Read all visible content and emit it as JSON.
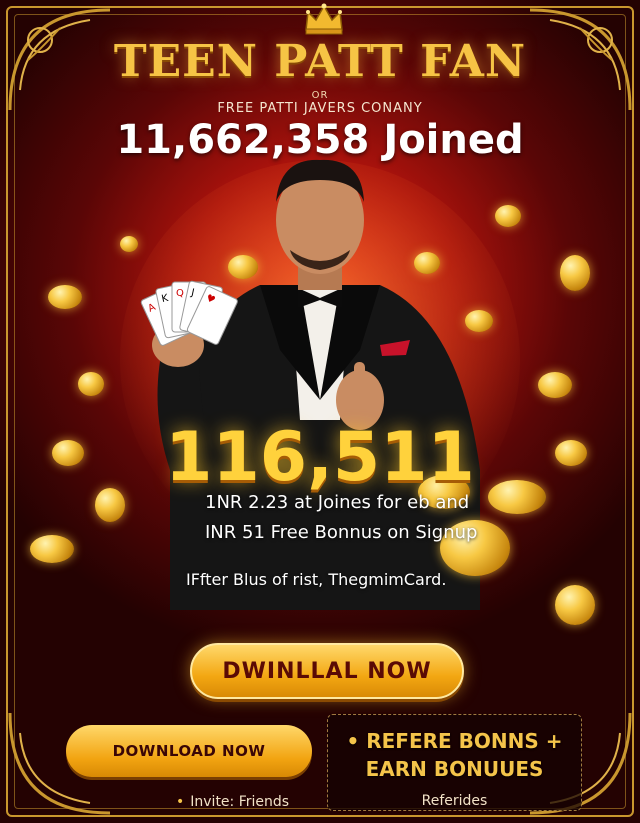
{
  "header": {
    "title": "TEEN PATT FAN",
    "small_label": "OR",
    "subtitle": "FREE PATTI JAVERS CONANY",
    "joined": "11,662,358 Joined"
  },
  "promo": {
    "amount": "116,511",
    "line1": "1NR 2.23 at Joines for eb and",
    "line2": "INR 51 Free Bonnus on Signup",
    "line3": "IFfter Blus of rist, ThegmimCard."
  },
  "buttons": {
    "main_cta": "DWINLLAL NOW",
    "download": "DOWNLOAD NOW"
  },
  "refer": {
    "line1": "• REFERE BONNS +",
    "line2": "EARN BONUUES",
    "footer": "Referides"
  },
  "invite": {
    "bullet": "•",
    "label": "Invite: Friends"
  },
  "icons": [
    "crown-icon",
    "coin-icon",
    "playing-cards-icon"
  ],
  "colors": {
    "gold": "#f6c445",
    "background_red": "#a8120c",
    "button_gold": "#f3a712",
    "dark_text": "#5a0a05"
  }
}
